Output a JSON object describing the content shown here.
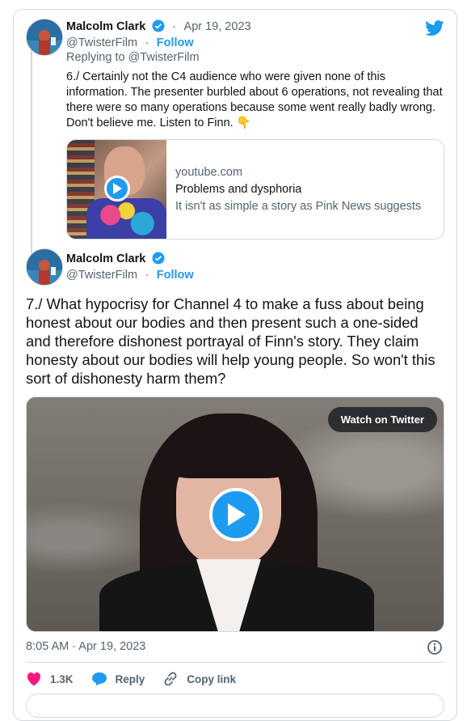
{
  "tweet1": {
    "author_name": "Malcolm Clark",
    "date": "Apr 19, 2023",
    "handle": "@TwisterFilm",
    "follow_label": "Follow",
    "replying_to": "Replying to @TwisterFilm",
    "text": "6./ Certainly not the C4 audience who were given none of this information. The presenter burbled about 6 operations, not revealing that there were so many operations because some went really badly wrong. Don't believe me. Listen to Finn.",
    "emoji": "👇",
    "link_card": {
      "domain": "youtube.com",
      "title": "Problems and dysphoria",
      "description": "It isn't as simple a story as Pink News suggests"
    }
  },
  "tweet2": {
    "author_name": "Malcolm Clark",
    "handle": "@TwisterFilm",
    "follow_label": "Follow",
    "text": "7./ What hypocrisy for Channel 4  to make a fuss about being honest about our bodies and then present such a one-sided and therefore dishonest portrayal of Finn's story. They claim honesty about our bodies will help young people. So won't this sort of dishonesty harm them?",
    "watch_label": "Watch on Twitter",
    "timestamp": "8:05 AM · Apr 19, 2023",
    "actions": {
      "likes": "1.3K",
      "reply_label": "Reply",
      "copy_label": "Copy link"
    }
  },
  "colors": {
    "accent": "#1d9bf0",
    "muted": "#536471",
    "like": "#f91880",
    "border": "#cfd9de"
  },
  "icons": [
    "twitter-bird-icon",
    "verified-badge-icon",
    "play-icon",
    "info-icon",
    "heart-icon",
    "reply-icon",
    "link-icon"
  ]
}
